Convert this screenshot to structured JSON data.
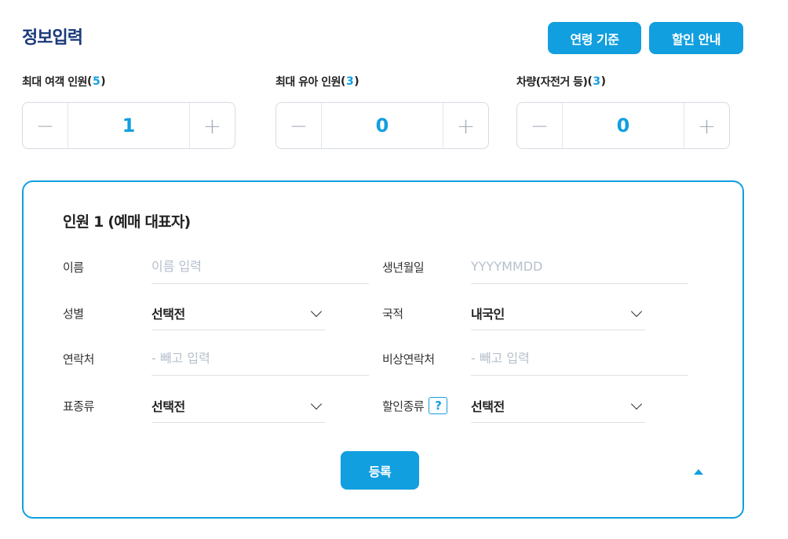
{
  "header": {
    "title": "정보입력",
    "age_criteria_label": "연령 기준",
    "discount_info_label": "할인 안내"
  },
  "counters": [
    {
      "label": "최대 여객 인원",
      "open": "(",
      "max": "5",
      "close": ")",
      "value": "1",
      "minus": "−",
      "plus": "+"
    },
    {
      "label": "최대 유아 인원",
      "open": "(",
      "max": "3",
      "close": ")",
      "value": "0",
      "minus": "−",
      "plus": "+"
    },
    {
      "label": "차량(자전거 등)",
      "open": "(",
      "max": "3",
      "close": ")",
      "value": "0",
      "minus": "−",
      "plus": "+"
    }
  ],
  "person": {
    "title": "인원 1 (예매 대표자)",
    "name": {
      "label": "이름",
      "placeholder": "이름 입력",
      "value": ""
    },
    "birth": {
      "label": "생년월일",
      "placeholder": "YYYYMMDD",
      "value": ""
    },
    "gender": {
      "label": "성별",
      "value": "선택전"
    },
    "nationality": {
      "label": "국적",
      "value": "내국인"
    },
    "phone": {
      "label": "연락처",
      "placeholder": "- 빼고 입력",
      "value": ""
    },
    "emergency": {
      "label": "비상연락처",
      "placeholder": "- 빼고 입력",
      "value": ""
    },
    "ticket_type": {
      "label": "표종류",
      "value": "선택전"
    },
    "discount_type": {
      "label": "할인종류",
      "help": "?",
      "value": "선택전"
    },
    "register_label": "등록"
  },
  "colors": {
    "accent": "#119fdf",
    "title": "#1a3a7a"
  },
  "icons": {
    "minus": "minus-icon",
    "plus": "plus-icon",
    "chevron": "chevron-down-icon",
    "collapse": "triangle-up-icon",
    "help": "help-icon"
  }
}
